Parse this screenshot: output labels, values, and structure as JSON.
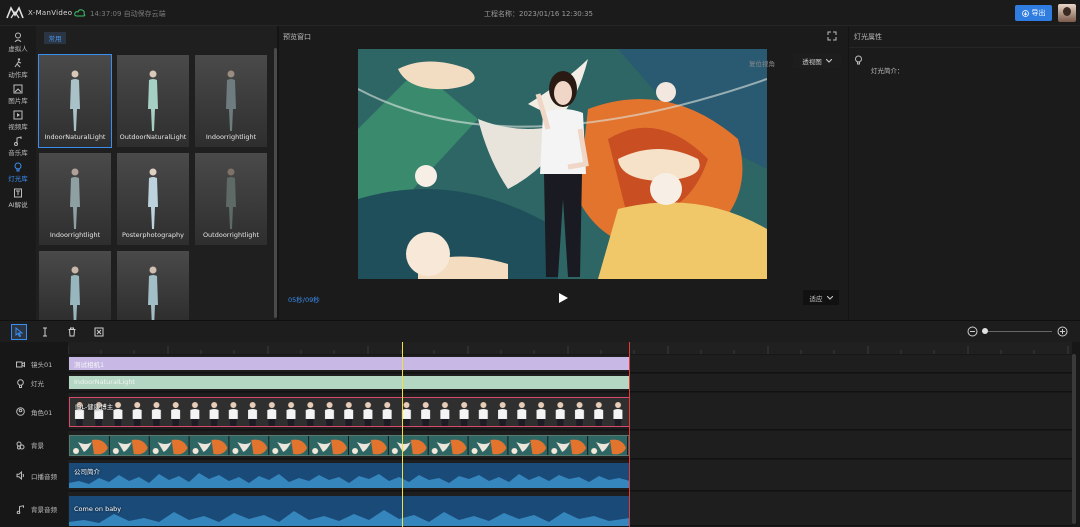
{
  "app": {
    "logo_text": "X-ManVideo",
    "save_status": "14:37:09 自动保存云端",
    "project_name": "工程名称：2023/01/16 12:30:35",
    "export_label": "导出"
  },
  "sidebar": {
    "items": [
      {
        "label": "虚拟人",
        "icon": "avatar-icon"
      },
      {
        "label": "动作库",
        "icon": "motion-icon"
      },
      {
        "label": "图片库",
        "icon": "image-icon"
      },
      {
        "label": "视频库",
        "icon": "video-icon"
      },
      {
        "label": "音乐库",
        "icon": "music-icon"
      },
      {
        "label": "灯光库",
        "icon": "bulb-icon",
        "active": true
      },
      {
        "label": "AI解说",
        "icon": "ai-icon"
      }
    ]
  },
  "library": {
    "tab": "常用",
    "items": [
      {
        "label": "IndoorNaturalLight"
      },
      {
        "label": "OutdoorNaturalLight"
      },
      {
        "label": "Indoorrightlight"
      },
      {
        "label": "Indoorrightlight"
      },
      {
        "label": "Posterphotography"
      },
      {
        "label": "Outdoorrightlight"
      },
      {
        "label": ""
      },
      {
        "label": ""
      }
    ]
  },
  "preview": {
    "title": "预览窗口",
    "camera_label": "复位视角",
    "view_select": "透视图",
    "time": "05秒/09秒",
    "fit_select": "适应"
  },
  "properties": {
    "title": "灯光属性",
    "intro_label": "灯光简介："
  },
  "timeline": {
    "tracks": [
      {
        "label": "镜头01",
        "clip": "测试相机1"
      },
      {
        "label": "灯光",
        "clip": "IndoorNaturalLight"
      },
      {
        "label": "角色01",
        "clip": "IBL-健康博主"
      },
      {
        "label": "背景",
        "clip": ""
      },
      {
        "label": "口播音频",
        "clip": "公司简介"
      },
      {
        "label": "背景音频",
        "clip": "Come on baby"
      }
    ]
  },
  "colors": {
    "accent": "#3a8ef0",
    "export": "#2f7de1",
    "camera_clip": "#c7b8e6",
    "light_clip": "#b3d7c3",
    "audio_clip": "#1a4a78",
    "playhead": "#f0e040",
    "end_marker": "#e23a3a"
  }
}
